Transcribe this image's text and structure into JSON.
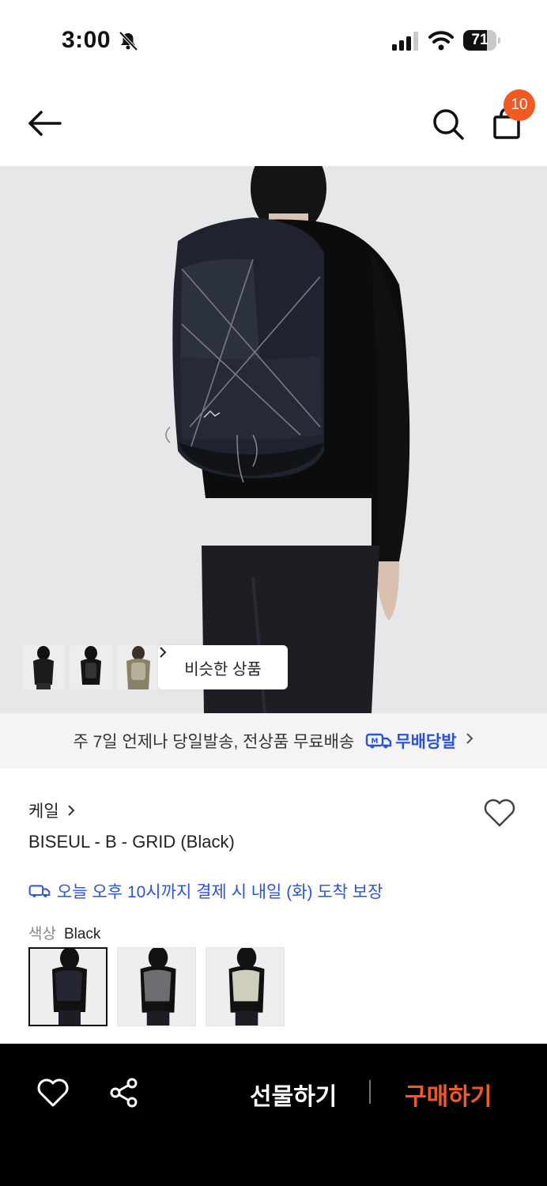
{
  "status_bar": {
    "time": "3:00",
    "battery": "71",
    "battery_level": 0.71
  },
  "header": {
    "cart_count": "10",
    "icons": [
      "back-arrow-icon",
      "search-icon",
      "shopping-bag-icon"
    ]
  },
  "gallery": {
    "similar_label": "비슷한 상품",
    "thumbnail_count": 3
  },
  "shipping_banner": {
    "text": "주 7일 언제나 당일발송, 전상품 무료배송",
    "brand": "무배당발",
    "accent": "#2d52d2"
  },
  "product": {
    "brand": "케일",
    "title": "BISEUL - B - GRID (Black)",
    "delivery_note": "오늘 오후 10시까지 결제 시 내일 (화) 도착 보장",
    "color_label": "색상",
    "color_value": "Black",
    "color_options": 3
  },
  "bottom_bar": {
    "gift_label": "선물하기",
    "buy_label": "구매하기",
    "buy_color": "#f15a22"
  }
}
